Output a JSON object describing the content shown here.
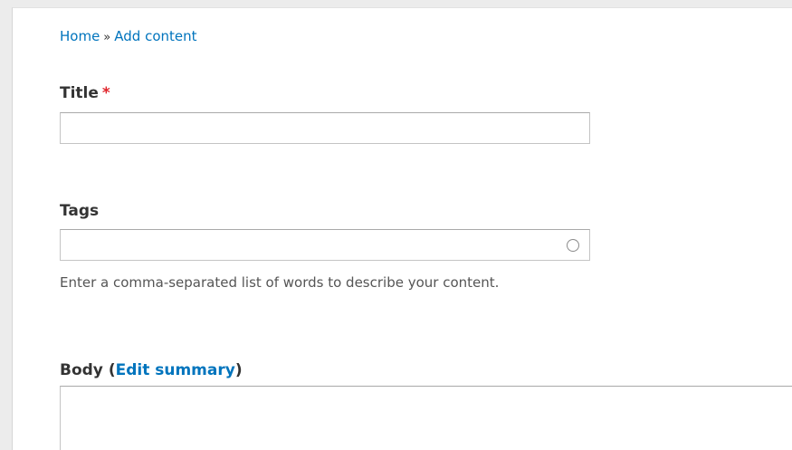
{
  "breadcrumb": {
    "home": "Home",
    "separator": "»",
    "current": "Add content"
  },
  "title_field": {
    "label": "Title",
    "required_marker": "*",
    "value": ""
  },
  "tags_field": {
    "label": "Tags",
    "value": "",
    "description": "Enter a comma-separated list of words to describe your content."
  },
  "body_field": {
    "label": "Body",
    "open_paren": "(",
    "edit_summary_link": "Edit summary",
    "close_paren": ")",
    "value": ""
  },
  "icons": {
    "autocomplete": "autocomplete-throbber-icon"
  },
  "colors": {
    "link": "#0074bd",
    "required": "#e0252b",
    "label_text": "#333333",
    "description_text": "#555555",
    "input_border": "#c4c4c4",
    "page_background": "#ffffff",
    "outer_background": "#ececec"
  }
}
